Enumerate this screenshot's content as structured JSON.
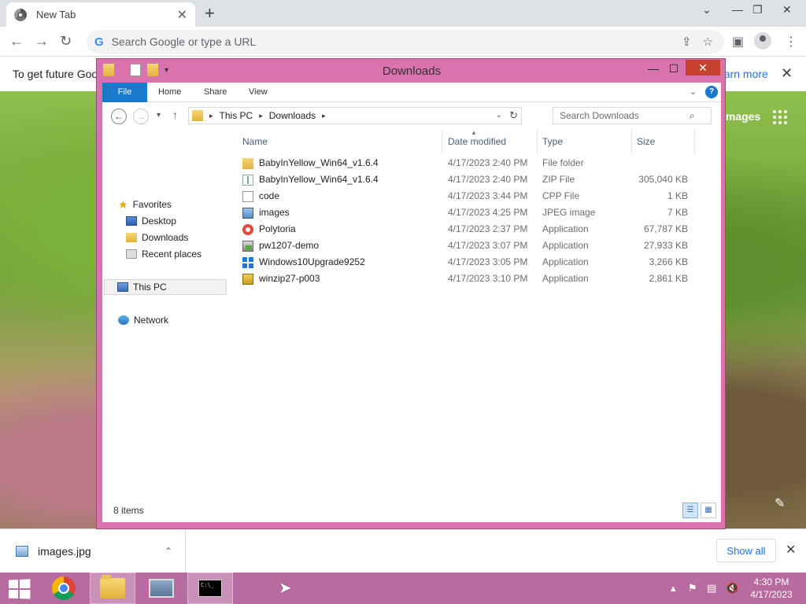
{
  "browser": {
    "tab_title": "New Tab",
    "omnibox_placeholder": "Search Google or type a URL",
    "info_text": "To get future Goog",
    "info_link": "earn more",
    "page_images_label": "Images",
    "download_file": "images.jpg",
    "show_all_label": "Show all"
  },
  "explorer": {
    "title": "Downloads",
    "ribbon_tabs": [
      "File",
      "Home",
      "Share",
      "View"
    ],
    "breadcrumb": [
      "This PC",
      "Downloads"
    ],
    "search_placeholder": "Search Downloads",
    "nav": {
      "favorites": "Favorites",
      "desktop": "Desktop",
      "downloads": "Downloads",
      "recent": "Recent places",
      "this_pc": "This PC",
      "network": "Network"
    },
    "columns": [
      "Name",
      "Date modified",
      "Type",
      "Size"
    ],
    "files": [
      {
        "name": "BabyInYellow_Win64_v1.6.4",
        "date": "4/17/2023 2:40 PM",
        "type": "File folder",
        "size": "",
        "icon": "folder-icon"
      },
      {
        "name": "BabyInYellow_Win64_v1.6.4",
        "date": "4/17/2023 2:40 PM",
        "type": "ZIP File",
        "size": "305,040 KB",
        "icon": "zip-file-icon"
      },
      {
        "name": "code",
        "date": "4/17/2023 3:44 PM",
        "type": "CPP File",
        "size": "1 KB",
        "icon": "file-icon"
      },
      {
        "name": "images",
        "date": "4/17/2023 4:25 PM",
        "type": "JPEG image",
        "size": "7 KB",
        "icon": "image-icon"
      },
      {
        "name": "Polytoria",
        "date": "4/17/2023 2:37 PM",
        "type": "Application",
        "size": "67,787 KB",
        "icon": "polytoria-icon"
      },
      {
        "name": "pw1207-demo",
        "date": "4/17/2023 3:07 PM",
        "type": "Application",
        "size": "27,933 KB",
        "icon": "setup-icon"
      },
      {
        "name": "Windows10Upgrade9252",
        "date": "4/17/2023 3:05 PM",
        "type": "Application",
        "size": "3,266 KB",
        "icon": "windows-icon"
      },
      {
        "name": "winzip27-p003",
        "date": "4/17/2023 3:10 PM",
        "type": "Application",
        "size": "2,861 KB",
        "icon": "winzip-icon"
      }
    ],
    "status": "8 items"
  },
  "taskbar": {
    "time": "4:30 PM",
    "date": "4/17/2023"
  },
  "colors": {
    "window_frame": "#d873ad",
    "taskbar": "#b86b9f",
    "ribbon_file_tab": "#1979ca",
    "close_button": "#c7412f",
    "link": "#1a73e8"
  }
}
